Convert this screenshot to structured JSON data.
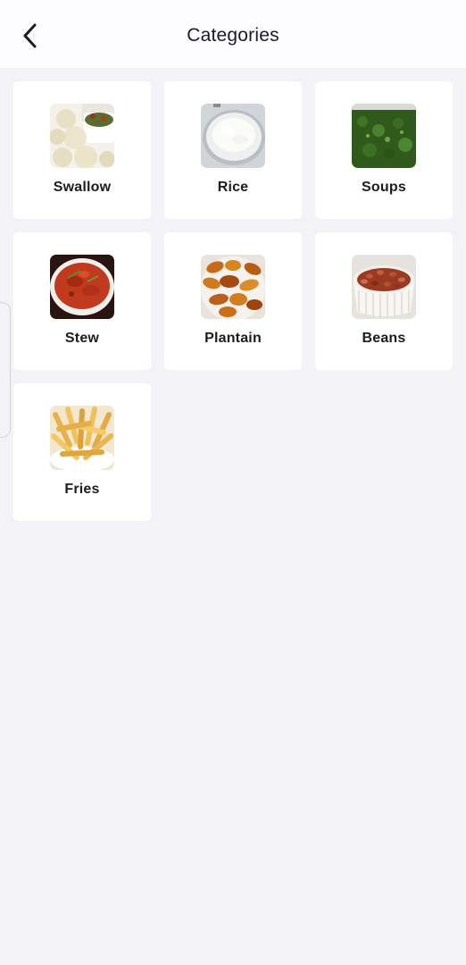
{
  "header": {
    "title": "Categories",
    "back_icon": "chevron-left-icon"
  },
  "categories": [
    {
      "label": "Swallow",
      "image": "swallow-image"
    },
    {
      "label": "Rice",
      "image": "rice-image"
    },
    {
      "label": "Soups",
      "image": "soups-image"
    },
    {
      "label": "Stew",
      "image": "stew-image"
    },
    {
      "label": "Plantain",
      "image": "plantain-image"
    },
    {
      "label": "Beans",
      "image": "beans-image"
    },
    {
      "label": "Fries",
      "image": "fries-image"
    }
  ],
  "colors": {
    "background": "#f3f2f6",
    "app_bar": "#fdfcff",
    "card": "#ffffff",
    "text": "#1d1d1f"
  }
}
